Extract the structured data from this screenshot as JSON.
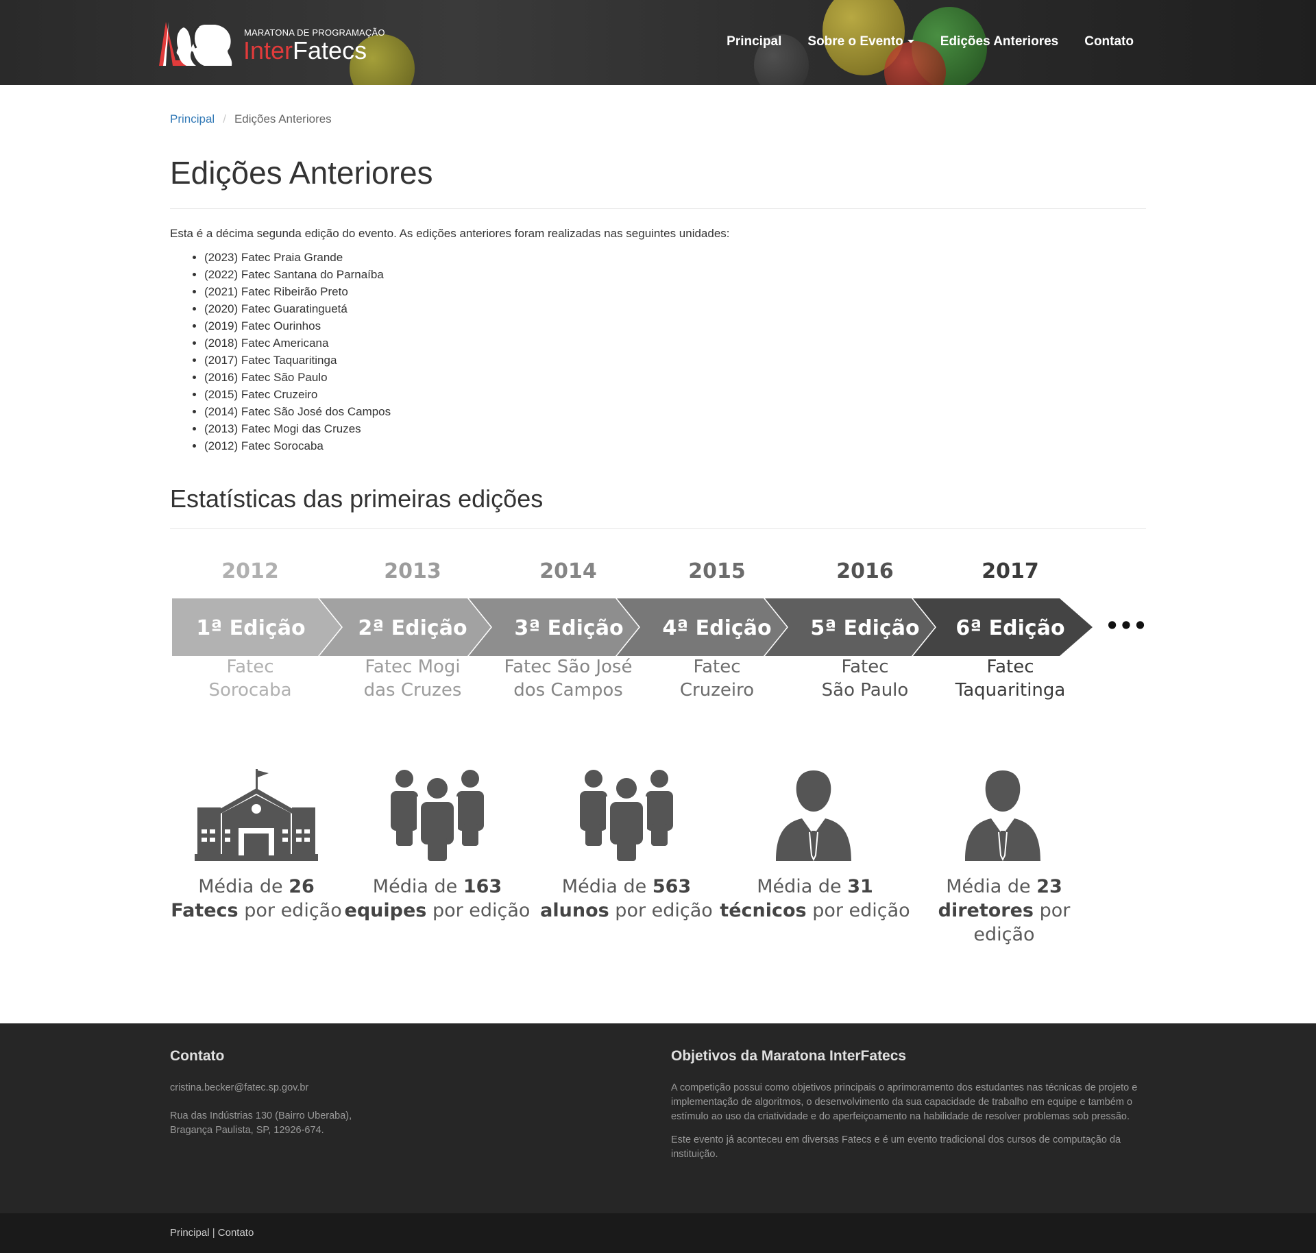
{
  "header": {
    "logo_subtitle": "MARATONA DE PROGRAMAÇÃO",
    "logo_inter": "Inter",
    "logo_fatecs": "Fatecs",
    "nav": [
      "Principal",
      "Sobre o Evento",
      "Edições Anteriores",
      "Contato"
    ]
  },
  "breadcrumb": {
    "home": "Principal",
    "current": "Edições Anteriores"
  },
  "page_title": "Edições Anteriores",
  "intro": "Esta é a décima segunda edição do evento. As edições anteriores foram realizadas nas seguintes unidades:",
  "editions": [
    "(2023) Fatec Praia Grande",
    "(2022) Fatec Santana do Parnaíba",
    "(2021) Fatec Ribeirão Preto",
    "(2020) Fatec Guaratinguetá",
    "(2019) Fatec Ourinhos",
    "(2018) Fatec Americana",
    "(2017) Fatec Taquaritinga",
    "(2016) Fatec São Paulo",
    "(2015) Fatec Cruzeiro",
    "(2014) Fatec São José dos Campos",
    "(2013) Fatec Mogi das Cruzes",
    "(2012) Fatec Sorocaba"
  ],
  "stats_title": "Estatísticas das primeiras edições",
  "timeline": [
    {
      "year": "2012",
      "label": "1ª Edição",
      "place": "Fatec\nSorocaba",
      "color": "#b2b2b2",
      "text_color": "#b0b0b0"
    },
    {
      "year": "2013",
      "label": "2ª Edição",
      "place": "Fatec Mogi\ndas Cruzes",
      "color": "#a2a2a2",
      "text_color": "#9c9c9c"
    },
    {
      "year": "2014",
      "label": "3ª Edição",
      "place": "Fatec São José\ndos Campos",
      "color": "#8e8e8e",
      "text_color": "#858585"
    },
    {
      "year": "2015",
      "label": "4ª Edição",
      "place": "Fatec\nCruzeiro",
      "color": "#787878",
      "text_color": "#6c6c6c"
    },
    {
      "year": "2016",
      "label": "5ª Edição",
      "place": "Fatec\nSão Paulo",
      "color": "#5f5f5f",
      "text_color": "#525252"
    },
    {
      "year": "2017",
      "label": "6ª Edição",
      "place": "Fatec\nTaquaritinga",
      "color": "#444444",
      "text_color": "#3a3a3a"
    }
  ],
  "timeline_more": "•••",
  "stats": [
    {
      "icon": "school-icon",
      "pre": "Média de ",
      "num": "26",
      "noun": "Fatecs",
      "post": " por edição"
    },
    {
      "icon": "team-icon",
      "pre": "Média de ",
      "num": "163",
      "noun": "equipes",
      "post": " por edição"
    },
    {
      "icon": "students-icon",
      "pre": "Média de ",
      "num": "563",
      "noun": "alunos",
      "post": " por edição"
    },
    {
      "icon": "person-tie-icon",
      "pre": "Média de ",
      "num": "31",
      "noun": "técnicos",
      "post": " por edição"
    },
    {
      "icon": "person-tie-icon",
      "pre": "Média de ",
      "num": "23",
      "noun": "diretores",
      "post": " por edição"
    }
  ],
  "footer": {
    "contact_title": "Contato",
    "email": "cristina.becker@fatec.sp.gov.br",
    "address_line1": "Rua das Indústrias 130 (Bairro Uberaba),",
    "address_line2": "Bragança Paulista, SP, 12926-674.",
    "objectives_title": "Objetivos da Maratona InterFatecs",
    "objectives_p1": "A competição possui como objetivos principais o aprimoramento dos estudantes nas técnicas de projeto e implementação de algoritmos, o desenvolvimento da sua capacidade de trabalho em equipe e também o estímulo ao uso da criatividade e do aperfeiçoamento na habilidade de resolver problemas sob pressão.",
    "objectives_p2": "Este evento já aconteceu em diversas Fatecs e é um evento tradicional dos cursos de computação da instituição.",
    "bottom_home": "Principal",
    "bottom_sep": " | ",
    "bottom_contact": "Contato"
  }
}
